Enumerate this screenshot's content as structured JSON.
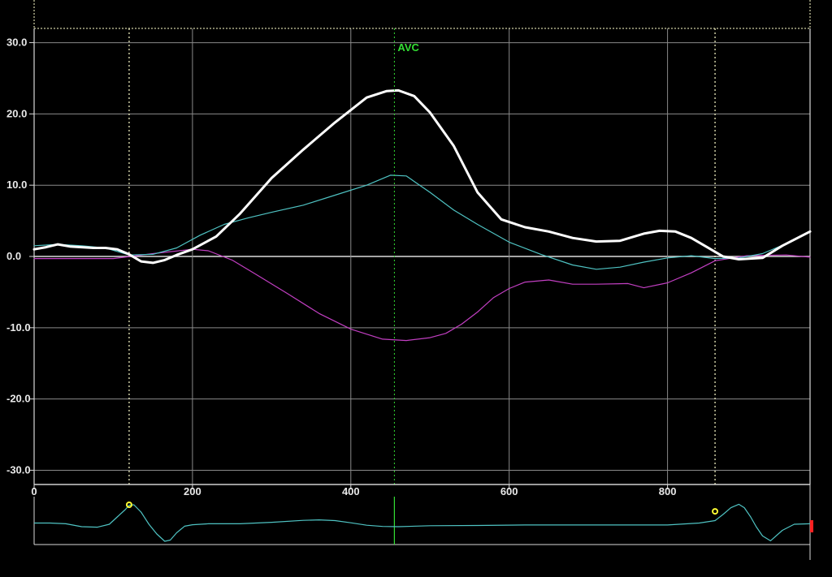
{
  "colors": {
    "background": "#000000",
    "grid": "#8a8a8a",
    "axis": "#d8d8d8",
    "strain_global": "#ffffff",
    "strain_cyan": "#4fc3c3",
    "strain_magenta": "#c23fc2",
    "avc_marker": "#33dd33",
    "ecg": "#4fc3c3",
    "ecg_point": "#ffff33",
    "edge_marker": "#ff2020"
  },
  "chart_data": [
    {
      "type": "line",
      "title": "",
      "xlabel": "",
      "ylabel": "",
      "xlim": [
        0,
        980
      ],
      "ylim": [
        -32,
        32
      ],
      "y_ticks": [
        30,
        20,
        10,
        0,
        -10,
        -20,
        -30
      ],
      "y_tick_labels": [
        "30.0",
        "20.0",
        "10.0",
        "0.0",
        "-10.0",
        "-20.0",
        "-30.0"
      ],
      "x_grid": [
        0,
        200,
        400,
        600,
        800
      ],
      "grid": true,
      "event_markers": [
        {
          "label": "AVC",
          "x": 455
        }
      ],
      "reference_lines_x": [
        120,
        860
      ],
      "series": [
        {
          "key": "white",
          "x": [
            0,
            15,
            30,
            45,
            60,
            75,
            90,
            105,
            120,
            135,
            150,
            165,
            180,
            200,
            230,
            260,
            300,
            340,
            380,
            420,
            445,
            460,
            480,
            500,
            530,
            560,
            590,
            620,
            650,
            680,
            710,
            740,
            770,
            790,
            810,
            830,
            850,
            870,
            890,
            920,
            945,
            980
          ],
          "y": [
            1.0,
            1.3,
            1.7,
            1.4,
            1.3,
            1.2,
            1.2,
            1.0,
            0.3,
            -0.7,
            -0.9,
            -0.5,
            0.2,
            1.0,
            2.8,
            6.0,
            11.0,
            15.0,
            18.8,
            22.3,
            23.2,
            23.3,
            22.5,
            20.2,
            15.5,
            9.0,
            5.2,
            4.1,
            3.5,
            2.6,
            2.1,
            2.2,
            3.2,
            3.6,
            3.5,
            2.6,
            1.3,
            0.0,
            -0.4,
            -0.2,
            1.5,
            3.5
          ]
        },
        {
          "key": "cyan",
          "x": [
            0,
            30,
            60,
            90,
            120,
            150,
            180,
            210,
            240,
            270,
            300,
            340,
            380,
            420,
            450,
            470,
            500,
            530,
            560,
            600,
            640,
            680,
            710,
            740,
            770,
            800,
            830,
            860,
            890,
            920,
            950,
            980
          ],
          "y": [
            1.5,
            1.7,
            1.5,
            1.2,
            0.2,
            0.3,
            1.2,
            3.0,
            4.5,
            5.4,
            6.2,
            7.2,
            8.6,
            10.0,
            11.4,
            11.3,
            9.0,
            6.5,
            4.5,
            2.0,
            0.3,
            -1.2,
            -1.8,
            -1.5,
            -0.8,
            -0.2,
            0.1,
            -0.3,
            -0.2,
            0.4,
            1.8,
            3.4
          ]
        },
        {
          "key": "magenta",
          "x": [
            0,
            50,
            100,
            150,
            200,
            220,
            250,
            280,
            320,
            360,
            400,
            440,
            470,
            500,
            520,
            540,
            560,
            580,
            600,
            620,
            650,
            680,
            710,
            750,
            770,
            800,
            830,
            860,
            900,
            950,
            980
          ],
          "y": [
            -0.3,
            -0.3,
            -0.3,
            0.4,
            1.0,
            0.8,
            -0.5,
            -2.5,
            -5.2,
            -8.0,
            -10.2,
            -11.6,
            -11.8,
            -11.4,
            -10.8,
            -9.5,
            -7.8,
            -5.8,
            -4.5,
            -3.6,
            -3.3,
            -3.9,
            -3.9,
            -3.8,
            -4.4,
            -3.7,
            -2.3,
            -0.6,
            0.1,
            0.2,
            -0.1
          ]
        }
      ]
    },
    {
      "type": "line",
      "title": "",
      "xlabel": "",
      "ylabel": "",
      "xlim": [
        0,
        980
      ],
      "ylim": [
        -1,
        1
      ],
      "x_ticks": [
        0,
        200,
        400,
        600,
        800
      ],
      "x_tick_labels": [
        "0",
        "200",
        "400",
        "600",
        "800"
      ],
      "event_markers": [
        {
          "label": "",
          "x": 455
        }
      ],
      "highlight_points": [
        {
          "x": 120,
          "y": 0.6
        },
        {
          "x": 860,
          "y": 0.33
        }
      ],
      "series": [
        {
          "key": "ecg",
          "x": [
            0,
            20,
            40,
            60,
            80,
            95,
            105,
            115,
            120,
            126,
            135,
            145,
            155,
            165,
            172,
            180,
            190,
            200,
            220,
            260,
            300,
            340,
            360,
            380,
            400,
            420,
            440,
            460,
            500,
            560,
            620,
            680,
            740,
            800,
            840,
            860,
            870,
            880,
            890,
            897,
            905,
            912,
            920,
            930,
            945,
            960,
            980
          ],
          "y": [
            -0.15,
            -0.15,
            -0.18,
            -0.3,
            -0.32,
            -0.2,
            0.1,
            0.4,
            0.58,
            0.6,
            0.3,
            -0.2,
            -0.6,
            -0.9,
            -0.85,
            -0.55,
            -0.28,
            -0.22,
            -0.18,
            -0.18,
            -0.12,
            -0.04,
            -0.02,
            -0.05,
            -0.14,
            -0.24,
            -0.29,
            -0.3,
            -0.26,
            -0.25,
            -0.23,
            -0.23,
            -0.23,
            -0.23,
            -0.15,
            -0.05,
            0.2,
            0.48,
            0.62,
            0.48,
            0.1,
            -0.3,
            -0.68,
            -0.88,
            -0.45,
            -0.2,
            -0.18
          ]
        }
      ]
    }
  ]
}
